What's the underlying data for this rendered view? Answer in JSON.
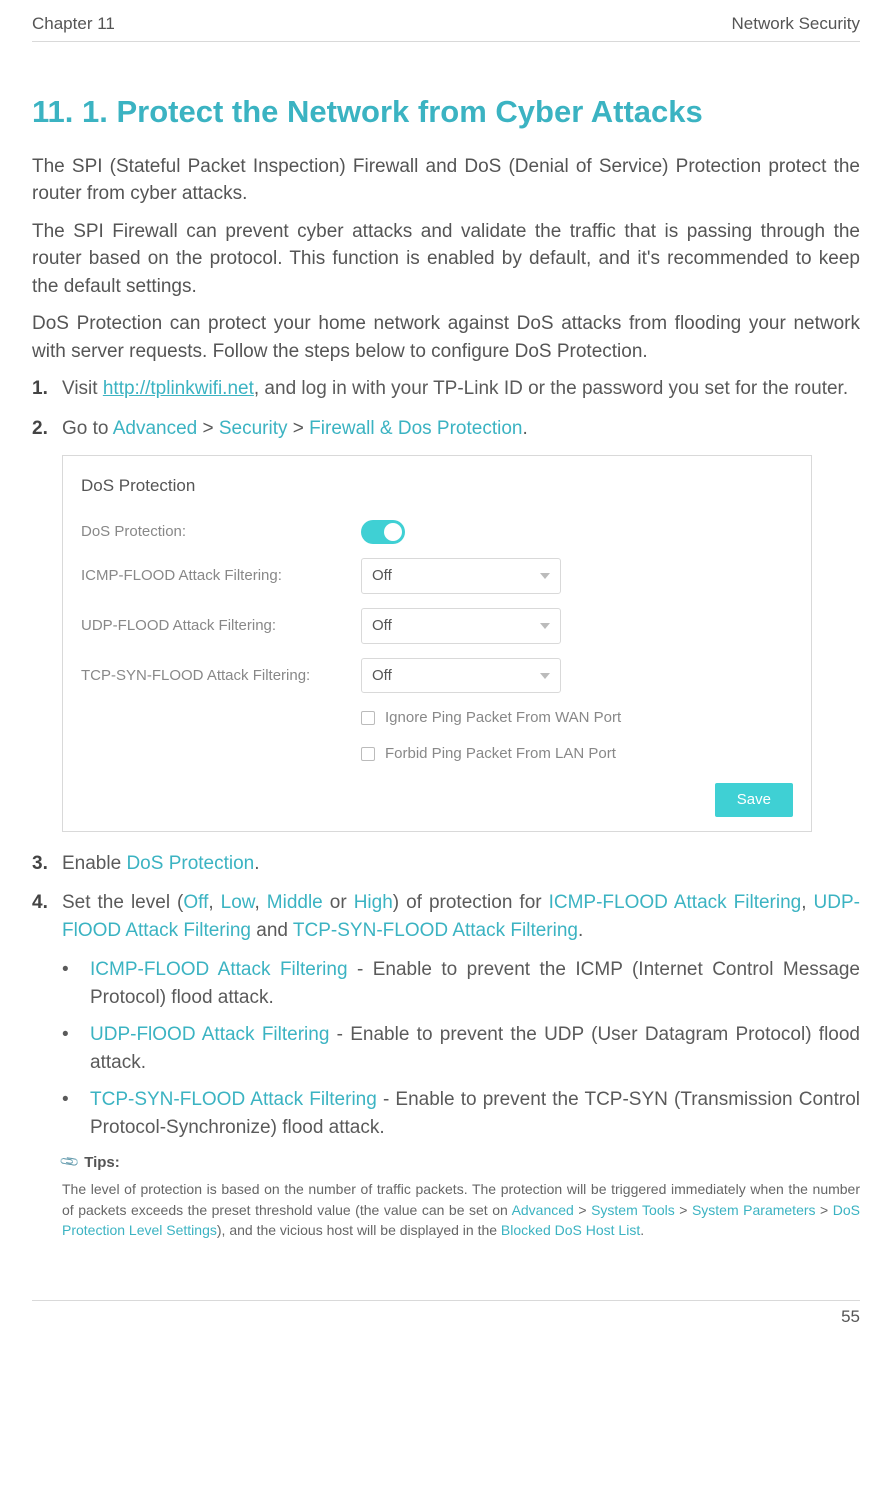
{
  "header": {
    "chapter": "Chapter 11",
    "topic": "Network Security"
  },
  "title": "11. 1.   Protect the Network from Cyber Attacks",
  "para1": "The SPI (Stateful Packet Inspection) Firewall and DoS (Denial of Service) Protection protect the router from cyber attacks.",
  "para2": "The SPI Firewall can prevent cyber attacks and validate the traffic that is passing through the router based on the protocol. This function is enabled by default, and it's recommended to keep the default settings.",
  "para3": "DoS Protection can protect your home network against DoS attacks from flooding your network with server requests. Follow the steps below to configure DoS Protection.",
  "step1": {
    "num": "1.",
    "pre": "Visit ",
    "link": "http://tplinkwifi.net",
    "post": ", and log in with your TP-Link ID or the password you set for the router."
  },
  "step2": {
    "num": "2.",
    "pre": "Go to ",
    "a": "Advanced",
    "gt1": " > ",
    "b": "Security",
    "gt2": " > ",
    "c": "Firewall & Dos Protection",
    "post": "."
  },
  "screenshot": {
    "title": "DoS Protection",
    "row_dos": "DoS Protection:",
    "row_icmp": "ICMP-FLOOD Attack Filtering:",
    "row_udp": "UDP-FLOOD Attack Filtering:",
    "row_tcp": "TCP-SYN-FLOOD Attack Filtering:",
    "off": "Off",
    "chk1": "Ignore Ping Packet From WAN Port",
    "chk2": "Forbid Ping Packet From LAN Port",
    "save": "Save"
  },
  "step3": {
    "num": "3.",
    "pre": "Enable ",
    "a": "DoS Protection",
    "post": "."
  },
  "step4": {
    "num": "4.",
    "t1": "Set the level (",
    "off": "Off",
    "c1": ", ",
    "low": "Low",
    "c2": ", ",
    "mid": "Middle",
    "c3": " or ",
    "high": "High",
    "t2": ") of protection for ",
    "icmp": "ICMP-FLOOD Attack Filtering",
    "c4": ", ",
    "udp": "UDP-FlOOD Attack Filtering",
    "t3": " and ",
    "tcp": "TCP-SYN-FLOOD Attack Filtering",
    "post": "."
  },
  "bullets": {
    "b1": {
      "label": "ICMP-FLOOD Attack Filtering",
      "desc": " - Enable to prevent the ICMP (Internet Control Message Protocol) flood attack."
    },
    "b2": {
      "label": "UDP-FlOOD Attack Filtering",
      "desc": " - Enable to prevent the UDP (User Datagram Protocol) flood attack."
    },
    "b3": {
      "label": "TCP-SYN-FLOOD Attack Filtering",
      "desc": " - Enable to prevent the TCP-SYN (Transmission Control Protocol-Synchronize) flood attack."
    }
  },
  "tips": {
    "head": "Tips:",
    "t1": "The level of protection is based on the number of traffic packets. The protection will be triggered immediately when the number of packets exceeds the preset threshold value (the value can be set on ",
    "a": "Advanced",
    "gt1": " > ",
    "b": "System Tools",
    "gt2": " > ",
    "c": "System Parameters",
    "gt3": " > ",
    "d": "DoS Protection Level Settings",
    "t2": "), and the vicious host will be displayed in the ",
    "e": "Blocked DoS Host List",
    "post": "."
  },
  "footer": {
    "page": "55"
  }
}
